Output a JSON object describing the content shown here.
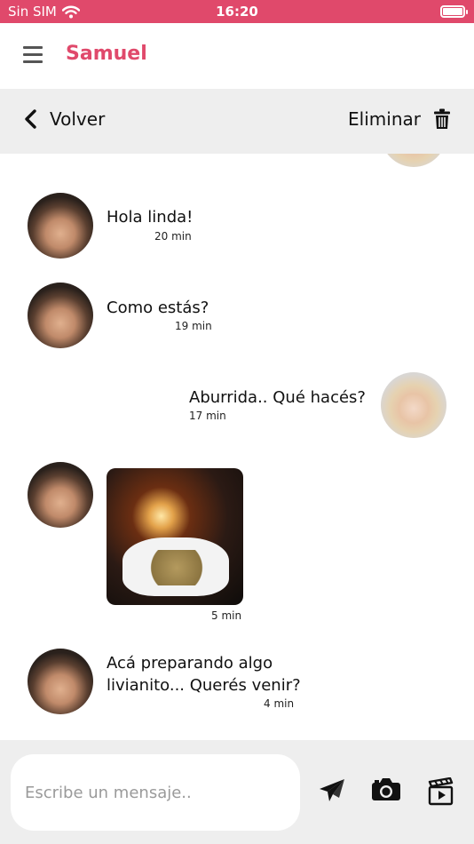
{
  "status_bar": {
    "carrier": "Sin SIM",
    "time": "16:20"
  },
  "header": {
    "title": "Samuel"
  },
  "nav": {
    "back_label": "Volver",
    "delete_label": "Eliminar"
  },
  "messages": [
    {
      "sender": "Samuel",
      "text": "Hola linda!",
      "time": "20 min"
    },
    {
      "sender": "Samuel",
      "text": "Como estás?",
      "time": "19 min"
    },
    {
      "sender": "me",
      "text": "Aburrida.. Qué hacés?",
      "time": "17 min"
    },
    {
      "sender": "Samuel",
      "type": "photo",
      "time": "5 min"
    },
    {
      "sender": "Samuel",
      "text_lines": [
        "Acá preparando algo",
        "livianito... Querés venir?"
      ],
      "time": "4 min"
    }
  ],
  "composer": {
    "placeholder": "Escribe un mensaje.."
  },
  "colors": {
    "accent": "#e0496b",
    "bar_bg": "#eeeeee"
  },
  "icons": {
    "menu": "hamburger-icon",
    "back": "chevron-left-icon",
    "delete": "trash-icon",
    "send": "paper-plane-icon",
    "camera": "camera-icon",
    "video": "clapperboard-icon"
  }
}
